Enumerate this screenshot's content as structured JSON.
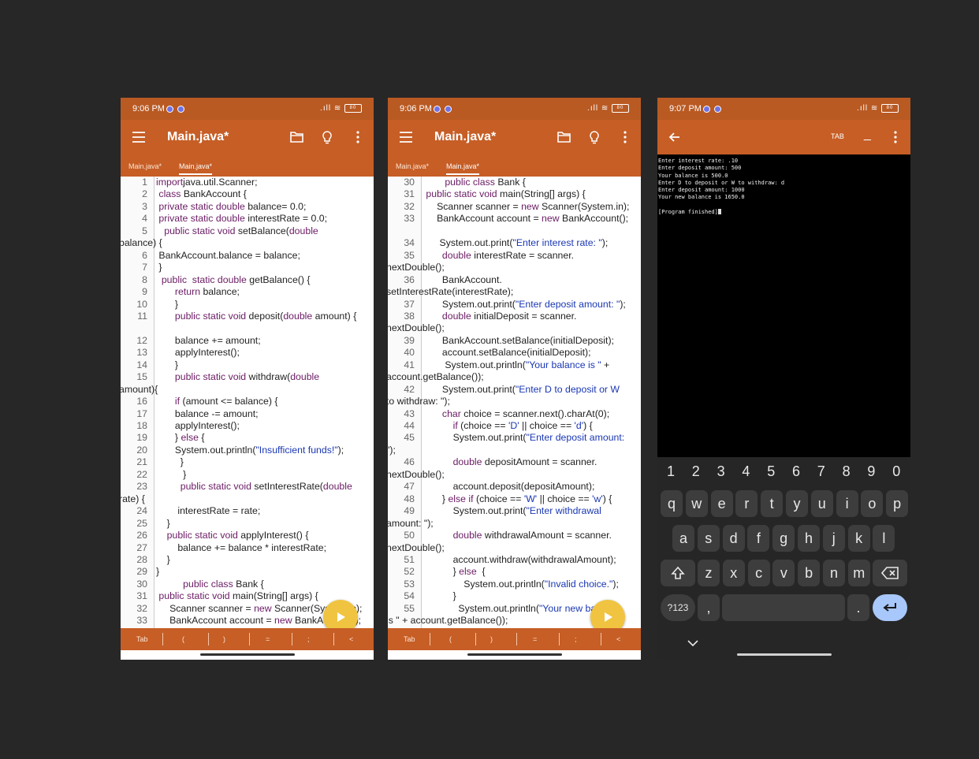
{
  "phones": [
    {
      "status_time": "9:06 PM",
      "battery": "80",
      "title": "Main.java*",
      "tabs": [
        "Main.java*",
        "Main.java*"
      ],
      "keybar": [
        "Tab",
        "(",
        ")",
        "=",
        ";",
        "<"
      ],
      "lines": [
        {
          "n": "1",
          "t": [
            [
              "kw",
              "import"
            ],
            [
              "",
              "java.util.Scanner;"
            ]
          ]
        },
        {
          "n": "2",
          "t": [
            [
              "kw",
              " class"
            ],
            [
              "",
              " BankAccount {"
            ]
          ]
        },
        {
          "n": "3",
          "t": [
            [
              "kw",
              " private static double"
            ],
            [
              "",
              " balance= 0.0;"
            ]
          ]
        },
        {
          "n": "4",
          "t": [
            [
              "kw",
              " private static double"
            ],
            [
              "",
              " interestRate = 0.0;"
            ]
          ]
        },
        {
          "n": "5",
          "t": [
            [
              "kw",
              "   public static void"
            ],
            [
              "",
              " setBalance("
            ],
            [
              "kw",
              "double"
            ]
          ],
          "c": "balance) {"
        },
        {
          "n": "6",
          "t": [
            [
              "",
              "",
              " BankAccount.balance = balance;"
            ]
          ]
        },
        {
          "n": "7",
          "t": [
            [
              "",
              " }"
            ]
          ]
        },
        {
          "n": "8",
          "t": [
            [
              "kw",
              "  public  static double"
            ],
            [
              "",
              " getBalance() {"
            ]
          ]
        },
        {
          "n": "9",
          "t": [
            [
              "kw",
              "       return"
            ],
            [
              "",
              " balance;"
            ]
          ]
        },
        {
          "n": "10",
          "t": [
            [
              "",
              "       }"
            ]
          ]
        },
        {
          "n": "11",
          "t": [
            [
              "kw",
              "       public static void"
            ],
            [
              "",
              " deposit("
            ],
            [
              "kw",
              "double"
            ],
            [
              "",
              " amount) {"
            ]
          ],
          "blank": true
        },
        {
          "n": "12",
          "t": [
            [
              "",
              "       balance += amount;"
            ]
          ]
        },
        {
          "n": "13",
          "t": [
            [
              "",
              "       applyInterest();"
            ]
          ]
        },
        {
          "n": "14",
          "t": [
            [
              "",
              "       }"
            ]
          ]
        },
        {
          "n": "15",
          "t": [
            [
              "kw",
              "       public static void"
            ],
            [
              "",
              " withdraw("
            ],
            [
              "kw",
              "double"
            ]
          ],
          "c": "amount){"
        },
        {
          "n": "16",
          "t": [
            [
              "kw",
              "       if"
            ],
            [
              "",
              " (amount <= balance) {"
            ]
          ]
        },
        {
          "n": "17",
          "t": [
            [
              "",
              "       balance -= amount;"
            ]
          ]
        },
        {
          "n": "18",
          "t": [
            [
              "",
              "       applyInterest();"
            ]
          ]
        },
        {
          "n": "19",
          "t": [
            [
              "",
              "       } "
            ],
            [
              "kw",
              "else"
            ],
            [
              "",
              " {"
            ]
          ]
        },
        {
          "n": "20",
          "t": [
            [
              "",
              "       System.out.println("
            ],
            [
              "str",
              "\"Insufficient funds!\""
            ],
            [
              "",
              ");"
            ]
          ]
        },
        {
          "n": "21",
          "t": [
            [
              "",
              "         }"
            ]
          ]
        },
        {
          "n": "22",
          "t": [
            [
              "",
              "          }"
            ]
          ]
        },
        {
          "n": "23",
          "t": [
            [
              "kw",
              "         public static void"
            ],
            [
              "",
              " setInterestRate("
            ],
            [
              "kw",
              "double"
            ]
          ],
          "c": "rate) {"
        },
        {
          "n": "24",
          "t": [
            [
              "",
              "        interestRate = rate;"
            ]
          ]
        },
        {
          "n": "25",
          "t": [
            [
              "",
              "    }"
            ]
          ]
        },
        {
          "n": "26",
          "t": [
            [
              "kw",
              "    public static void"
            ],
            [
              "",
              " applyInterest() {"
            ]
          ]
        },
        {
          "n": "27",
          "t": [
            [
              "",
              "        balance += balance * interestRate;"
            ]
          ]
        },
        {
          "n": "28",
          "t": [
            [
              "",
              "    }"
            ]
          ]
        },
        {
          "n": "29",
          "t": [
            [
              "",
              "}"
            ]
          ]
        },
        {
          "n": "30",
          "t": [
            [
              "kw",
              "          public class"
            ],
            [
              "",
              " Bank {"
            ]
          ]
        },
        {
          "n": "31",
          "t": [
            [
              "kw",
              " public static void"
            ],
            [
              "",
              " main(String[] args) {"
            ]
          ]
        },
        {
          "n": "32",
          "t": [
            [
              "",
              "     Scanner scanner = "
            ],
            [
              "kw",
              "new"
            ],
            [
              "",
              " Scanner(System.in);"
            ]
          ]
        },
        {
          "n": "33",
          "t": [
            [
              "",
              "     BankAccount account = "
            ],
            [
              "kw",
              "new"
            ],
            [
              "",
              " BankAccount();"
            ]
          ]
        }
      ]
    },
    {
      "status_time": "9:06 PM",
      "battery": "80",
      "title": "Main.java*",
      "tabs": [
        "Main.java*",
        "Main.java*"
      ],
      "keybar": [
        "Tab",
        "(",
        ")",
        "=",
        ";",
        "<"
      ],
      "lines": [
        {
          "n": "30",
          "t": [
            [
              "kw",
              "        public class"
            ],
            [
              "",
              " Bank {"
            ]
          ]
        },
        {
          "n": "31",
          "t": [
            [
              "kw",
              " public static void"
            ],
            [
              "",
              " main(String[] args) {"
            ]
          ]
        },
        {
          "n": "32",
          "t": [
            [
              "",
              "     Scanner scanner = "
            ],
            [
              "kw",
              "new"
            ],
            [
              "",
              " Scanner(System.in);"
            ]
          ]
        },
        {
          "n": "33",
          "t": [
            [
              "",
              "     BankAccount account = "
            ],
            [
              "kw",
              "new"
            ],
            [
              "",
              " BankAccount();"
            ]
          ],
          "blank": true
        },
        {
          "n": "34",
          "t": [
            [
              "",
              "      System.out.print("
            ],
            [
              "str",
              "\"Enter interest rate: \""
            ],
            [
              "",
              ");"
            ]
          ]
        },
        {
          "n": "35",
          "t": [
            [
              "kw",
              "       double"
            ],
            [
              "",
              " interestRate = scanner."
            ]
          ],
          "c": "nextDouble();"
        },
        {
          "n": "36",
          "t": [
            [
              "",
              "       BankAccount."
            ]
          ],
          "c": "setInterestRate(interestRate);"
        },
        {
          "n": "37",
          "t": [
            [
              "",
              "       System.out.print("
            ],
            [
              "str",
              "\"Enter deposit amount: \""
            ],
            [
              "",
              ");"
            ]
          ]
        },
        {
          "n": "38",
          "t": [
            [
              "kw",
              "       double"
            ],
            [
              "",
              " initialDeposit = scanner."
            ]
          ],
          "c": "nextDouble();"
        },
        {
          "n": "39",
          "t": [
            [
              "",
              "       BankAccount.setBalance(initialDeposit);"
            ]
          ]
        },
        {
          "n": "40",
          "t": [
            [
              "",
              "       account.setBalance(initialDeposit);"
            ]
          ]
        },
        {
          "n": "41",
          "t": [
            [
              "",
              "        System.out.println("
            ],
            [
              "str",
              "\"Your balance is \""
            ],
            [
              "",
              " +"
            ]
          ],
          "c": "account.getBalance());"
        },
        {
          "n": "42",
          "t": [
            [
              "",
              "       System.out.print("
            ],
            [
              "str",
              "\"Enter D to deposit or W"
            ]
          ],
          "c": "to withdraw: \");"
        },
        {
          "n": "43",
          "t": [
            [
              "kw",
              "       char"
            ],
            [
              "",
              " choice = scanner.next().charAt(0);"
            ]
          ]
        },
        {
          "n": "44",
          "t": [
            [
              "kw",
              "           if"
            ],
            [
              "",
              " (choice == "
            ],
            [
              "str",
              "'D'"
            ],
            [
              "",
              " || choice == "
            ],
            [
              "str",
              "'d'"
            ],
            [
              "",
              ") {"
            ]
          ]
        },
        {
          "n": "45",
          "t": [
            [
              "",
              "           System.out.print("
            ],
            [
              "str",
              "\"Enter deposit amount:"
            ]
          ],
          "c": "\");"
        },
        {
          "n": "46",
          "t": [
            [
              "kw",
              "           double"
            ],
            [
              "",
              " depositAmount = scanner."
            ]
          ],
          "c": "nextDouble();"
        },
        {
          "n": "47",
          "t": [
            [
              "",
              "           account.deposit(depositAmount);"
            ]
          ]
        },
        {
          "n": "48",
          "t": [
            [
              "",
              "       } "
            ],
            [
              "kw",
              "else if"
            ],
            [
              "",
              " (choice == "
            ],
            [
              "str",
              "'W'"
            ],
            [
              "",
              " || choice == "
            ],
            [
              "str",
              "'w'"
            ],
            [
              "",
              ") {"
            ]
          ]
        },
        {
          "n": "49",
          "t": [
            [
              "",
              "           System.out.print("
            ],
            [
              "str",
              "\"Enter withdrawal"
            ]
          ],
          "c": "amount: \");"
        },
        {
          "n": "50",
          "t": [
            [
              "kw",
              "           double"
            ],
            [
              "",
              " withdrawalAmount = scanner."
            ]
          ],
          "c": "nextDouble();"
        },
        {
          "n": "51",
          "t": [
            [
              "",
              "           account.withdraw(withdrawalAmount);"
            ]
          ]
        },
        {
          "n": "52",
          "t": [
            [
              "",
              "           } "
            ],
            [
              "kw",
              "else"
            ],
            [
              "",
              "  {"
            ]
          ]
        },
        {
          "n": "53",
          "t": [
            [
              "",
              "               System.out.println("
            ],
            [
              "str",
              "\"Invalid choice.\""
            ],
            [
              "",
              ");"
            ]
          ]
        },
        {
          "n": "54",
          "t": [
            [
              "",
              "           }"
            ]
          ]
        },
        {
          "n": "55",
          "t": [
            [
              "",
              "             System.out.println("
            ],
            [
              "str",
              "\"Your new balance"
            ]
          ],
          "c": "is \" + account.getBalance());"
        }
      ]
    }
  ],
  "terminal": {
    "status_time": "9:07 PM",
    "battery": "80",
    "tab_label": "TAB",
    "underscore": "_",
    "output": [
      "Enter interest rate: .10",
      "Enter deposit amount: 500",
      "Your balance is 500.0",
      "Enter D to deposit or W to withdraw: d",
      "Enter deposit amount: 1000",
      "Your new balance is 1650.0",
      "",
      "[Program finished]"
    ],
    "keyboard": {
      "numbers": [
        "1",
        "2",
        "3",
        "4",
        "5",
        "6",
        "7",
        "8",
        "9",
        "0"
      ],
      "row1": [
        "q",
        "w",
        "e",
        "r",
        "t",
        "y",
        "u",
        "i",
        "o",
        "p"
      ],
      "row2": [
        "a",
        "s",
        "d",
        "f",
        "g",
        "h",
        "j",
        "k",
        "l"
      ],
      "row3": [
        "z",
        "x",
        "c",
        "v",
        "b",
        "n",
        "m"
      ],
      "symbols_key": "?123",
      "comma": ",",
      "period": "."
    }
  },
  "colors": {
    "toolbar": "#c65e26",
    "keyword": "#6a1b64",
    "string": "#1a37b3",
    "fab": "#f0c440",
    "enter_key": "#a8c7fa"
  }
}
